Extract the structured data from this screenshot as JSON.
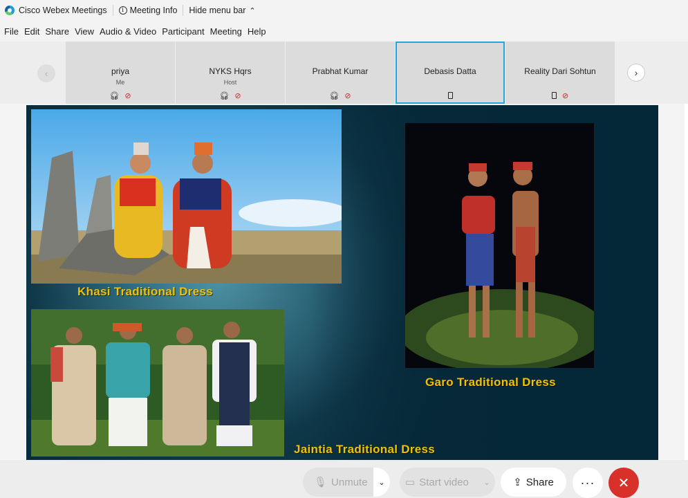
{
  "titlebar": {
    "app_name": "Cisco Webex Meetings",
    "meeting_info": "Meeting Info",
    "hide_menu": "Hide menu bar"
  },
  "menu": [
    "File",
    "Edit",
    "Share",
    "View",
    "Audio & Video",
    "Participant",
    "Meeting",
    "Help"
  ],
  "participants": [
    {
      "name": "priya",
      "role": "Me",
      "icons": [
        "headset-icon",
        "muted-mic-icon"
      ]
    },
    {
      "name": "NYKS Hqrs",
      "role": "Host",
      "icons": [
        "headset-icon",
        "muted-mic-icon"
      ]
    },
    {
      "name": "Prabhat Kumar",
      "role": "",
      "icons": [
        "headset-icon",
        "muted-mic-icon"
      ]
    },
    {
      "name": "Debasis Datta",
      "role": "",
      "icons": [
        "phone-icon"
      ],
      "active": true
    },
    {
      "name": "Reality Dari Sohtun",
      "role": "",
      "icons": [
        "phone-icon",
        "muted-mic-icon"
      ]
    }
  ],
  "slide": {
    "captions": {
      "khasi": "Khasi Traditional Dress",
      "garo": "Garo Traditional Dress",
      "jaintia": "Jaintia Traditional Dress"
    },
    "caption_color": "#f2c200"
  },
  "controls": {
    "unmute": "Unmute",
    "start_video": "Start video",
    "share": "Share",
    "more": "···",
    "end_icon": "close-icon"
  },
  "colors": {
    "active_border": "#1fa6e0",
    "mute_red": "#d0262d",
    "end_red": "#d8312a"
  }
}
